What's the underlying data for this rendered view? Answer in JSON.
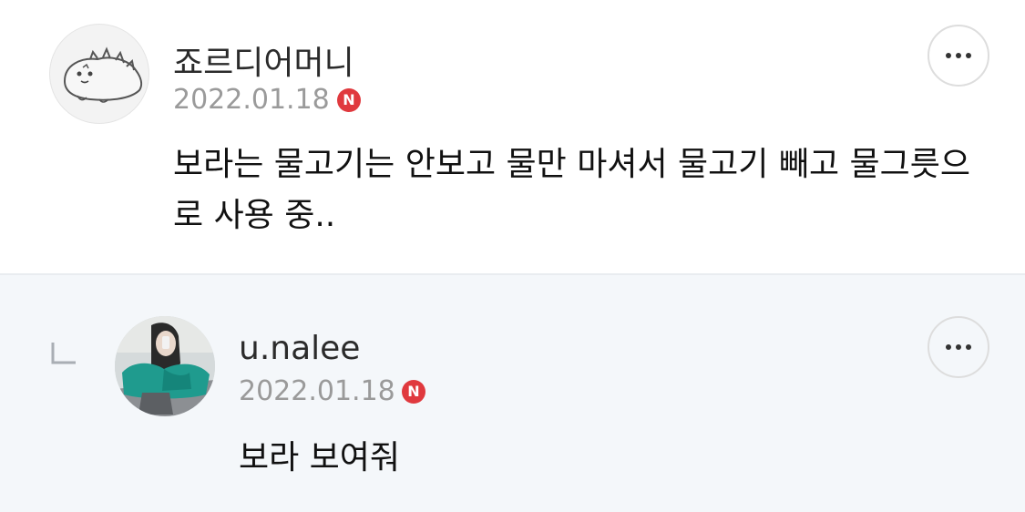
{
  "comments": [
    {
      "author": "죠르디어머니",
      "date": "2022.01.18",
      "badge": "N",
      "text": "보라는 물고기는 안보고 물만 마셔서 물고기 빼고 물그릇으로 사용 중..",
      "avatar_icon": "jordy-character-avatar",
      "more_icon": "more-options-icon"
    }
  ],
  "replies": [
    {
      "author": "u.nalee",
      "date": "2022.01.18",
      "badge": "N",
      "text": "보라 보여줘",
      "avatar_icon": "user-photo-avatar",
      "more_icon": "more-options-icon",
      "reply_icon": "reply-indicator-icon"
    }
  ],
  "colors": {
    "badge": "#e0393e",
    "reply_background": "#f4f7fa",
    "date_text": "#9a9a9a"
  }
}
